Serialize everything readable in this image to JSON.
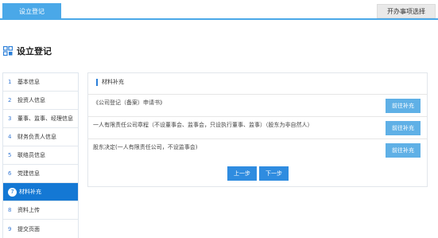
{
  "topbar": {
    "active_tab": "设立登记",
    "right_button": "开办事项选择"
  },
  "page": {
    "title": "设立登记",
    "title_icon": "grid-icon"
  },
  "steps": [
    {
      "num": "1",
      "label": "基本信息",
      "active": false
    },
    {
      "num": "2",
      "label": "投资人信息",
      "active": false
    },
    {
      "num": "3",
      "label": "董事、监事、经理信息",
      "active": false
    },
    {
      "num": "4",
      "label": "财务负责人信息",
      "active": false
    },
    {
      "num": "5",
      "label": "联络员信息",
      "active": false
    },
    {
      "num": "6",
      "label": "党建信息",
      "active": false
    },
    {
      "num": "7",
      "label": "材料补充",
      "active": true
    },
    {
      "num": "8",
      "label": "资料上传",
      "active": false
    },
    {
      "num": "9",
      "label": "提交页面",
      "active": false
    }
  ],
  "panel": {
    "title": "材料补充",
    "items": [
      {
        "text": "《公司登记（备案）申请书》",
        "button": "前往补充"
      },
      {
        "text": "一人有限责任公司章程（不设董事会、监事会，只设执行董事、监事）（股东为非自然人）",
        "button": "前往补充"
      },
      {
        "text": "股东决定(一人有限责任公司，不设监事会)",
        "button": "前往补充"
      }
    ],
    "prev_button": "上一步",
    "next_button": "下一步"
  },
  "colors": {
    "accent": "#4aa8e8",
    "active_step": "#1478d4",
    "button": "#5fb0e6",
    "nav_button": "#2f8ce0"
  }
}
